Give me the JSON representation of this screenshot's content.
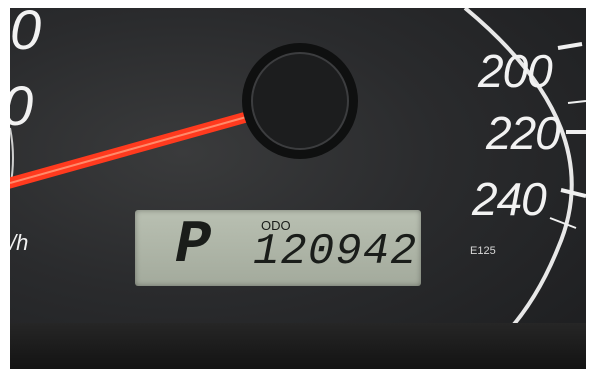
{
  "dashboard": {
    "speed_scale": [
      "200",
      "220",
      "240"
    ],
    "left_partial_digits": [
      "0",
      "0"
    ],
    "speed_unit": "/h",
    "emission_code": "E125"
  },
  "display": {
    "gear": "P",
    "odo_label": "ODO",
    "odometer": "120942"
  },
  "colors": {
    "needle": "#ff3a1e",
    "lcd_background": "#aeb5a7",
    "dial_face": "#2a2b2d"
  }
}
